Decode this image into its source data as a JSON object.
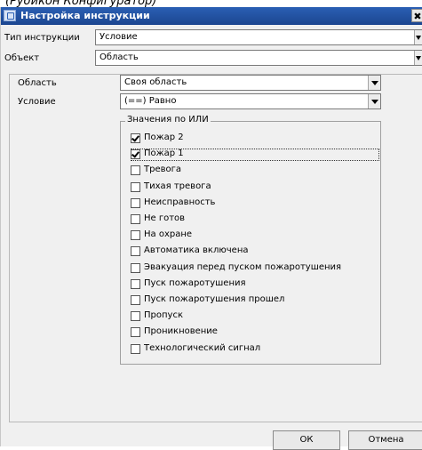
{
  "caption": "(Рубикон Конфигуратор)",
  "window": {
    "title": "Настройка инструкции",
    "close_label": "✖"
  },
  "instruction_type": {
    "label": "Тип инструкции",
    "value": "Условие"
  },
  "object": {
    "label": "Объект",
    "value": "Область"
  },
  "area": {
    "label": "Область",
    "value": "Своя область"
  },
  "condition": {
    "label": "Условие",
    "value": "(==) Равно"
  },
  "values_group": {
    "title": "Значения по ИЛИ",
    "items": [
      {
        "label": "Пожар 2",
        "checked": true
      },
      {
        "label": "Пожар 1",
        "checked": true
      },
      {
        "label": "Тревога",
        "checked": false
      },
      {
        "label": "Тихая тревога",
        "checked": false
      },
      {
        "label": "Неисправность",
        "checked": false
      },
      {
        "label": "Не готов",
        "checked": false
      },
      {
        "label": "На охране",
        "checked": false
      },
      {
        "label": "Автоматика включена",
        "checked": false
      },
      {
        "label": "Эвакуация перед пуском пожаротушения",
        "checked": false
      },
      {
        "label": "Пуск пожаротушения",
        "checked": false
      },
      {
        "label": "Пуск пожаротушения прошел",
        "checked": false
      },
      {
        "label": "Пропуск",
        "checked": false
      },
      {
        "label": "Проникновение",
        "checked": false
      },
      {
        "label": "Технологический сигнал",
        "checked": false
      }
    ]
  },
  "buttons": {
    "ok": "ОК",
    "cancel": "Отмена"
  }
}
